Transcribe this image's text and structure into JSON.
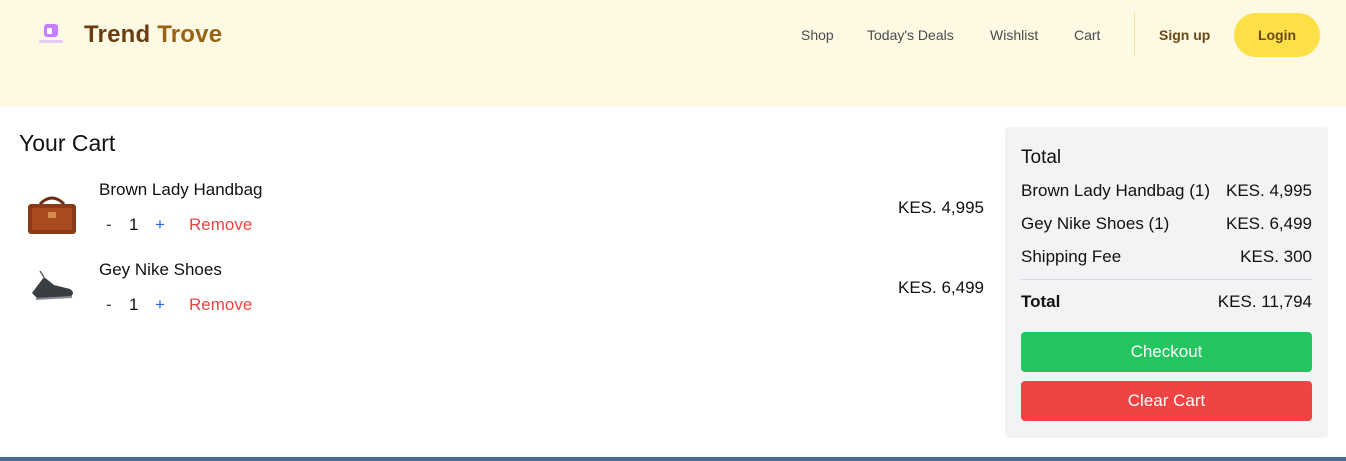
{
  "header": {
    "brand_word1": "Trend",
    "brand_word2": "Trove",
    "nav": [
      "Shop",
      "Today's Deals",
      "Wishlist",
      "Cart"
    ],
    "signup": "Sign up",
    "login": "Login"
  },
  "cart": {
    "title": "Your Cart",
    "items": [
      {
        "name": "Brown Lady Handbag",
        "qty": "1",
        "minus": "-",
        "plus": "+",
        "remove": "Remove",
        "price": "KES. 4,995"
      },
      {
        "name": "Gey Nike Shoes",
        "qty": "1",
        "minus": "-",
        "plus": "+",
        "remove": "Remove",
        "price": "KES. 6,499"
      }
    ]
  },
  "summary": {
    "title": "Total",
    "rows": [
      {
        "label": "Brown Lady Handbag (1)",
        "value": "KES. 4,995"
      },
      {
        "label": "Gey Nike Shoes (1)",
        "value": "KES. 6,499"
      },
      {
        "label": "Shipping Fee",
        "value": "KES. 300"
      }
    ],
    "total_label": "Total",
    "total_value": "KES. 11,794",
    "checkout": "Checkout",
    "clear": "Clear Cart"
  },
  "colors": {
    "header_bg": "#fef9e3",
    "login_bg": "#fde047",
    "checkout_bg": "#22c55e",
    "clear_bg": "#ef4444",
    "remove_text": "#ef4444",
    "plus_text": "#2563eb"
  }
}
